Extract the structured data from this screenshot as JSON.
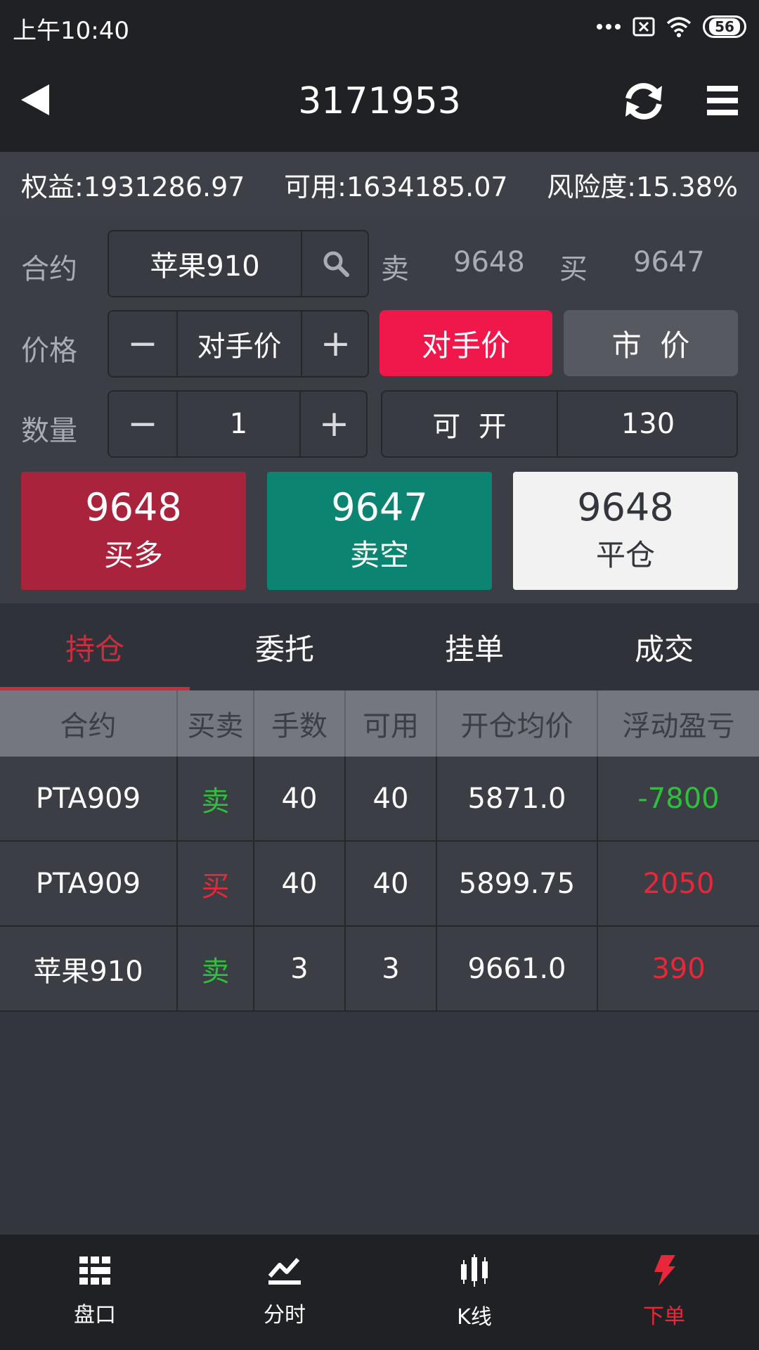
{
  "status": {
    "time": "上午10:40",
    "battery": "56"
  },
  "header": {
    "title": "3171953"
  },
  "account": {
    "equity": "权益:1931286.97",
    "available": "可用:1634185.07",
    "risk": "风险度:15.38%"
  },
  "form": {
    "contract_label": "合约",
    "contract_value": "苹果910",
    "sell_label": "卖",
    "sell_price": "9648",
    "buy_label": "买",
    "buy_price": "9647",
    "price_label": "价格",
    "price_value": "对手价",
    "minus": "−",
    "plus": "+",
    "counter_btn": "对手价",
    "market_btn": "市  价",
    "qty_label": "数量",
    "qty_value": "1",
    "openable_label": "可  开",
    "openable_value": "130"
  },
  "actions": {
    "buy_long": {
      "price": "9648",
      "label": "买多"
    },
    "sell_short": {
      "price": "9647",
      "label": "卖空"
    },
    "close": {
      "price": "9648",
      "label": "平仓"
    }
  },
  "tabs": [
    "持仓",
    "委托",
    "挂单",
    "成交"
  ],
  "table": {
    "headers": [
      "合约",
      "买卖",
      "手数",
      "可用",
      "开仓均价",
      "浮动盈亏"
    ],
    "rows": [
      [
        "PTA909",
        "卖",
        "40",
        "40",
        "5871.0",
        "-7800"
      ],
      [
        "PTA909",
        "买",
        "40",
        "40",
        "5899.75",
        "2050"
      ],
      [
        "苹果910",
        "卖",
        "3",
        "3",
        "9661.0",
        "390"
      ]
    ]
  },
  "nav": [
    "盘口",
    "分时",
    "K线",
    "下单"
  ],
  "colors": {
    "accent_red": "#f0184a",
    "buy_red": "#a8233b",
    "sell_green": "#0b8471",
    "profit_green": "#2fbf3d",
    "loss_red": "#e8283a"
  }
}
